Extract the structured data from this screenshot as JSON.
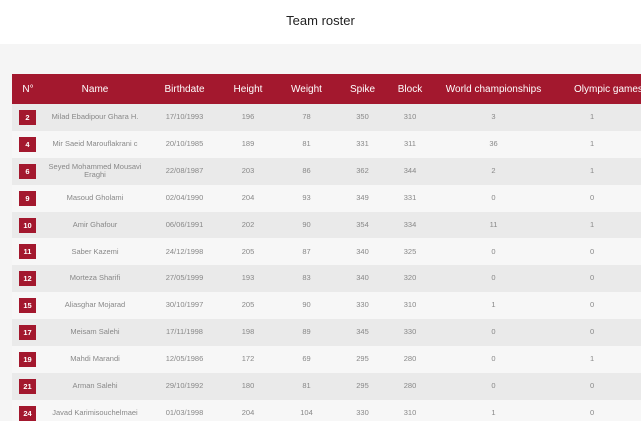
{
  "header": {
    "title": "Team roster"
  },
  "table": {
    "columns": [
      "N°",
      "Name",
      "Birthdate",
      "Height",
      "Weight",
      "Spike",
      "Block",
      "World championships",
      "Olympic games"
    ],
    "rows": [
      {
        "no": "2",
        "name": "Milad Ebadipour Ghara H.",
        "birthdate": "17/10/1993",
        "height": "196",
        "weight": "78",
        "spike": "350",
        "block": "310",
        "wc": "3",
        "og": "1"
      },
      {
        "no": "4",
        "name": "Mir Saeid Marouflakrani c",
        "birthdate": "20/10/1985",
        "height": "189",
        "weight": "81",
        "spike": "331",
        "block": "311",
        "wc": "36",
        "og": "1"
      },
      {
        "no": "6",
        "name": "Seyed Mohammed Mousavi Eraghi",
        "birthdate": "22/08/1987",
        "height": "203",
        "weight": "86",
        "spike": "362",
        "block": "344",
        "wc": "2",
        "og": "1"
      },
      {
        "no": "9",
        "name": "Masoud Gholami",
        "birthdate": "02/04/1990",
        "height": "204",
        "weight": "93",
        "spike": "349",
        "block": "331",
        "wc": "0",
        "og": "0"
      },
      {
        "no": "10",
        "name": "Amir Ghafour",
        "birthdate": "06/06/1991",
        "height": "202",
        "weight": "90",
        "spike": "354",
        "block": "334",
        "wc": "11",
        "og": "1"
      },
      {
        "no": "11",
        "name": "Saber Kazemi",
        "birthdate": "24/12/1998",
        "height": "205",
        "weight": "87",
        "spike": "340",
        "block": "325",
        "wc": "0",
        "og": "0"
      },
      {
        "no": "12",
        "name": "Morteza Sharifi",
        "birthdate": "27/05/1999",
        "height": "193",
        "weight": "83",
        "spike": "340",
        "block": "320",
        "wc": "0",
        "og": "0"
      },
      {
        "no": "15",
        "name": "Aliasghar Mojarad",
        "birthdate": "30/10/1997",
        "height": "205",
        "weight": "90",
        "spike": "330",
        "block": "310",
        "wc": "1",
        "og": "0"
      },
      {
        "no": "17",
        "name": "Meisam Salehi",
        "birthdate": "17/11/1998",
        "height": "198",
        "weight": "89",
        "spike": "345",
        "block": "330",
        "wc": "0",
        "og": "0"
      },
      {
        "no": "19",
        "name": "Mahdi Marandi",
        "birthdate": "12/05/1986",
        "height": "172",
        "weight": "69",
        "spike": "295",
        "block": "280",
        "wc": "0",
        "og": "1"
      },
      {
        "no": "21",
        "name": "Arman Salehi",
        "birthdate": "29/10/1992",
        "height": "180",
        "weight": "81",
        "spike": "295",
        "block": "280",
        "wc": "0",
        "og": "0"
      },
      {
        "no": "24",
        "name": "Javad Karimisouchelmaei",
        "birthdate": "01/03/1998",
        "height": "204",
        "weight": "104",
        "spike": "330",
        "block": "310",
        "wc": "1",
        "og": "0"
      }
    ]
  },
  "colors": {
    "accent": "#a3182e",
    "row_odd": "#eaeaea",
    "row_even": "#f7f7f7"
  }
}
